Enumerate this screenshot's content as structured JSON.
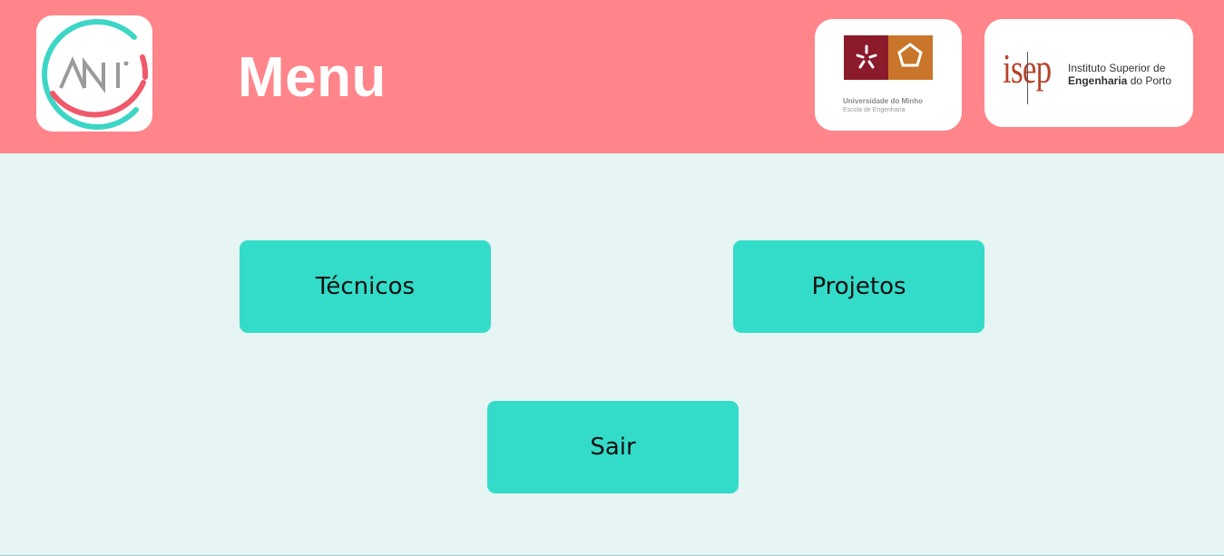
{
  "header": {
    "title": "Menu",
    "logos": {
      "ani": {
        "text": "ANI",
        "icon": "ani-logo-icon"
      },
      "uminho": {
        "name": "Universidade do Minho",
        "school": "Escola de Engenharia",
        "icon": "uminho-logo-icon"
      },
      "isep": {
        "word": "isep",
        "line1": "Instituto Superior de",
        "line2_bold": "Engenharia",
        "line2_rest": " do Porto",
        "icon": "isep-logo-icon"
      }
    }
  },
  "menu": {
    "buttons": [
      {
        "label": "Técnicos"
      },
      {
        "label": "Projetos"
      },
      {
        "label": "Sair"
      }
    ]
  },
  "colors": {
    "header_bg": "#ff858b",
    "page_bg": "#e6f4f3",
    "button_bg": "#33dcc8",
    "title_text": "#ffffff",
    "uminho_red": "#8b1a2b",
    "uminho_orange": "#c9762a",
    "isep_red": "#b5442a"
  }
}
